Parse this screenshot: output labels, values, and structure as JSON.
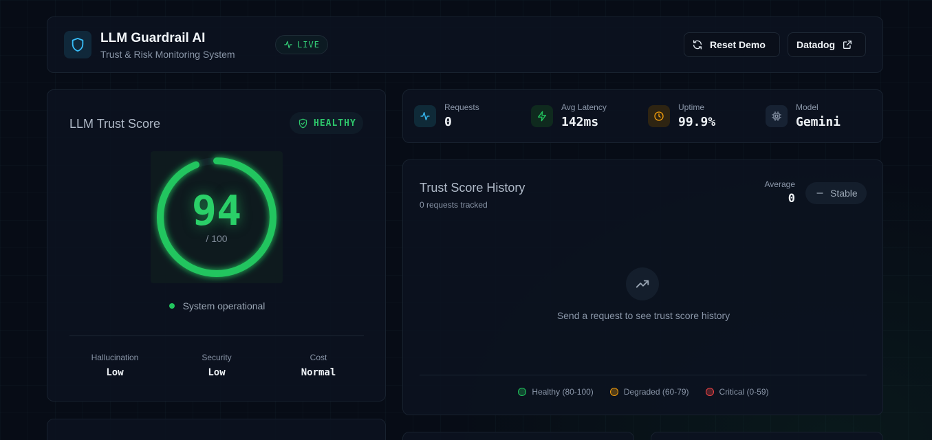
{
  "header": {
    "title": "LLM Guardrail AI",
    "subtitle": "Trust & Risk Monitoring System",
    "live_label": "LIVE",
    "reset_label": "Reset Demo",
    "datadog_label": "Datadog"
  },
  "trust_card": {
    "title": "LLM Trust Score",
    "badge": "HEALTHY",
    "score": "94",
    "score_max": "/ 100",
    "score_fraction": 0.94,
    "status": "System operational",
    "metrics": [
      {
        "label": "Hallucination",
        "value": "Low"
      },
      {
        "label": "Security",
        "value": "Low"
      },
      {
        "label": "Cost",
        "value": "Normal"
      }
    ]
  },
  "stats": [
    {
      "label": "Requests",
      "value": "0",
      "icon": "activity-icon",
      "color": "#38bdf8"
    },
    {
      "label": "Avg Latency",
      "value": "142ms",
      "icon": "zap-icon",
      "color": "#22c55e"
    },
    {
      "label": "Uptime",
      "value": "99.9%",
      "icon": "clock-icon",
      "color": "#f59e0b"
    },
    {
      "label": "Model",
      "value": "Gemini",
      "icon": "cpu-icon",
      "color": "#8a96a8"
    }
  ],
  "history": {
    "title": "Trust Score History",
    "subtitle": "0 requests tracked",
    "average_label": "Average",
    "average_value": "0",
    "trend": "Stable",
    "empty_text": "Send a request to see trust score history",
    "legend": [
      {
        "label": "Healthy (80-100)",
        "color": "#22c55e"
      },
      {
        "label": "Degraded (60-79)",
        "color": "#f59e0b"
      },
      {
        "label": "Critical (0-59)",
        "color": "#ef4444"
      }
    ]
  },
  "colors": {
    "accent_green": "#2ad068",
    "accent_cyan": "#38bdf8",
    "background": "#070c16"
  }
}
